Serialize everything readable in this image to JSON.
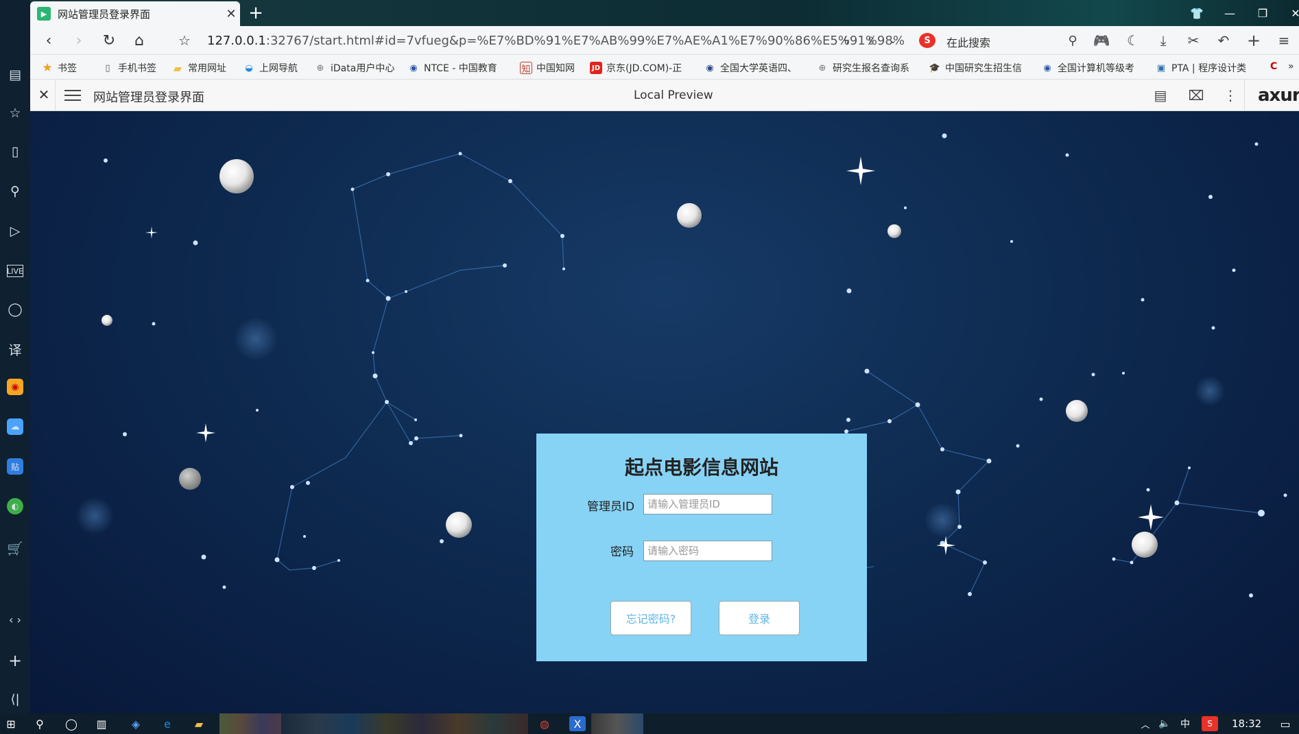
{
  "browser": {
    "tab_title": "网站管理员登录界面",
    "url_host": "127.0.0.1",
    "url_rest": ":32767/start.html#id=7vfueg&p=%E7%BD%91%E7%AB%99%E7%AE%A1%E7%90%86%E5%91%98%",
    "search_placeholder": "在此搜索",
    "search_engine_icon": "S"
  },
  "bookmarks": [
    {
      "label": "书签",
      "icon": "star-icon",
      "color": "#f0a020"
    },
    {
      "label": "手机书签",
      "icon": "phone-icon",
      "color": "#555555"
    },
    {
      "label": "常用网址",
      "icon": "folder-icon",
      "color": "#f2c043"
    },
    {
      "label": "上网导航",
      "icon": "globe-icon",
      "color": "#1e88e5"
    },
    {
      "label": "iData用户中心",
      "icon": "globe-icon",
      "color": "#777777"
    },
    {
      "label": "NTCE - 中国教育",
      "icon": "globe-icon",
      "color": "#2b57a8"
    },
    {
      "label": "中国知网",
      "icon": "cnki-icon",
      "color": "#c0392b"
    },
    {
      "label": "京东(JD.COM)-正",
      "icon": "jd-icon",
      "color": "#e1251b"
    },
    {
      "label": "全国大学英语四、",
      "icon": "globe-icon",
      "color": "#2b4a8a"
    },
    {
      "label": "研究生报名查询系",
      "icon": "globe-icon",
      "color": "#777777"
    },
    {
      "label": "中国研究生招生信",
      "icon": "cap-icon",
      "color": "#1f3a66"
    },
    {
      "label": "全国计算机等级考",
      "icon": "globe-icon",
      "color": "#2b57a8"
    },
    {
      "label": "PTA | 程序设计类",
      "icon": "pta-icon",
      "color": "#2f6fb0"
    }
  ],
  "axure": {
    "page_title": "网站管理员登录界面",
    "preview_label": "Local Preview",
    "logo": "axure"
  },
  "login": {
    "title": "起点电影信息网站",
    "id_label": "管理员ID",
    "id_placeholder": "请输入管理员ID",
    "password_label": "密码",
    "password_placeholder": "请输入密码",
    "forgot_button": "忘记密码?",
    "login_button": "登录"
  },
  "taskbar": {
    "ime": "中",
    "clock": "18:32"
  },
  "colors": {
    "panel_bg": "#87d3f5",
    "button_text": "#5fb7e6",
    "space_bg": "#0e2a50"
  }
}
